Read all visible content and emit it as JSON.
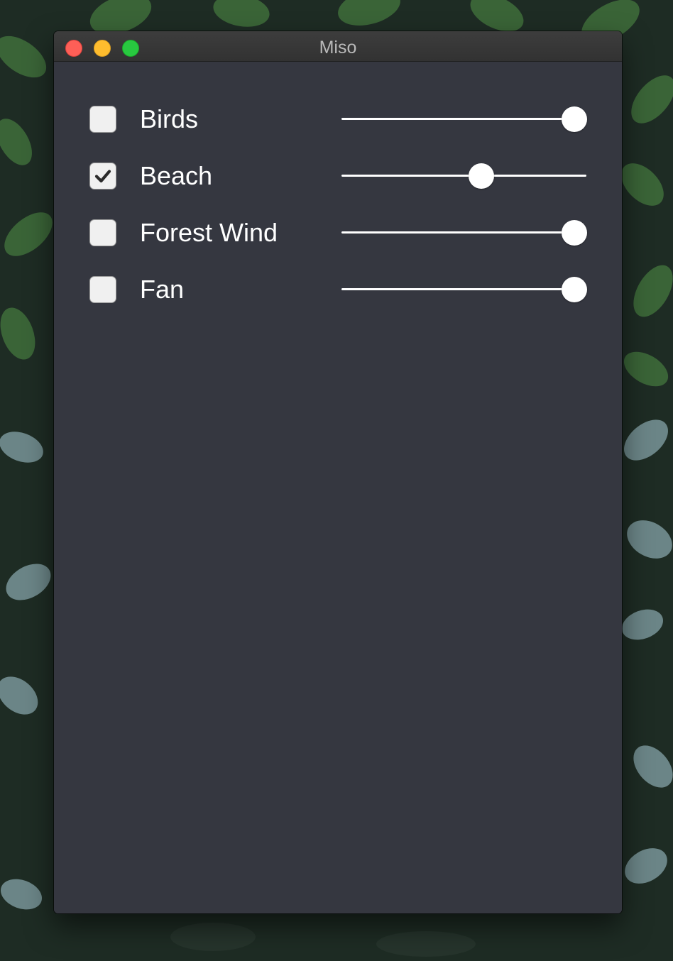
{
  "window": {
    "title": "Miso"
  },
  "sounds": [
    {
      "label": "Birds",
      "checked": false,
      "volume": 0.95
    },
    {
      "label": "Beach",
      "checked": true,
      "volume": 0.57
    },
    {
      "label": "Forest Wind",
      "checked": false,
      "volume": 0.95
    },
    {
      "label": "Fan",
      "checked": false,
      "volume": 0.95
    }
  ],
  "colors": {
    "window_bg": "#353740",
    "titlebar": "#383838",
    "close": "#fe5f57",
    "minimize": "#febc2e",
    "maximize": "#28c840",
    "text": "#ffffff"
  },
  "icons": {
    "checkmark": "checkmark-icon"
  }
}
